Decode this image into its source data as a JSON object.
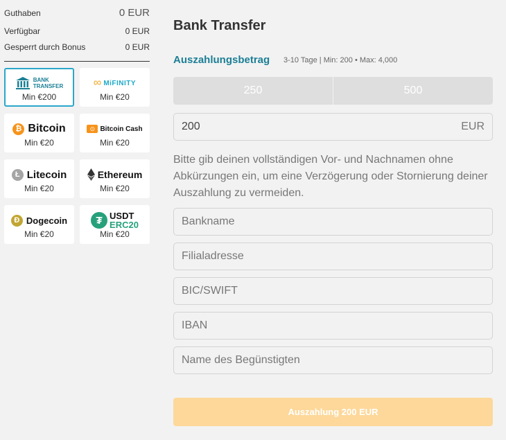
{
  "balances": [
    {
      "label": "Guthaben",
      "value": "0 EUR"
    },
    {
      "label": "Verfügbar",
      "value": "0 EUR"
    },
    {
      "label": "Gesperrt durch Bonus",
      "value": "0 EUR"
    }
  ],
  "methods": [
    {
      "name": "Bank Transfer",
      "logo_line1": "BANK",
      "logo_line2": "TRANSFER",
      "min": "Min €200",
      "icon": "bank-icon",
      "color": "#1b7f95"
    },
    {
      "name": "MiFinity",
      "logo_text": "MiFINITY",
      "min": "Min €20",
      "icon": "infinity-icon",
      "color": "#1ea9c8"
    },
    {
      "name": "Bitcoin",
      "logo_text": "Bitcoin",
      "glyph": "₿",
      "min": "Min €20",
      "icon": "bitcoin-icon",
      "color": "#f7931a"
    },
    {
      "name": "Bitcoin Cash",
      "logo_text": "Bitcoin Cash",
      "glyph": "⊙",
      "min": "Min €20",
      "icon": "bitcoin-cash-icon",
      "color": "#f7931a"
    },
    {
      "name": "Litecoin",
      "logo_text": "Litecoin",
      "glyph": "Ł",
      "min": "Min €20",
      "icon": "litecoin-icon",
      "color": "#a5a5a5"
    },
    {
      "name": "Ethereum",
      "logo_text": "Ethereum",
      "glyph": "◆",
      "min": "Min €20",
      "icon": "ethereum-icon",
      "color": "#333333"
    },
    {
      "name": "Dogecoin",
      "logo_text": "Dogecoin",
      "glyph": "Ð",
      "min": "Min €20",
      "icon": "dogecoin-icon",
      "color": "#c2a633"
    },
    {
      "name": "USDT ERC20",
      "logo_line1": "USDT",
      "logo_line2": "ERC20",
      "glyph": "₮",
      "min": "Min €20",
      "icon": "tether-icon",
      "color": "#26a17b"
    }
  ],
  "form": {
    "title": "Bank Transfer",
    "amount_label": "Auszahlungsbetrag",
    "amount_info": "3-10 Tage | Min: 200 • Max: 4,000",
    "quick_amounts": [
      "250",
      "500"
    ],
    "amount_value": "200",
    "currency": "EUR",
    "notice": "Bitte gib deinen vollständigen Vor- und Nachnamen ohne Abkürzungen ein, um eine Verzögerung oder Stornierung deiner Auszahlung zu vermeiden.",
    "placeholders": {
      "bank_name": "Bankname",
      "branch_address": "Filialadresse",
      "bic": "BIC/SWIFT",
      "iban": "IBAN",
      "beneficiary": "Name des Begünstigten"
    },
    "submit_label": "Auszahlung 200 EUR",
    "accent": "#1b7f95",
    "submit_color": "#fdd89a"
  }
}
